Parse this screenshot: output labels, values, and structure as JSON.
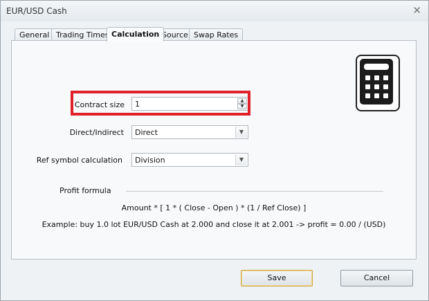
{
  "window": {
    "title": "EUR/USD Cash"
  },
  "tabs": [
    {
      "label": "General"
    },
    {
      "label": "Trading Times"
    },
    {
      "label": "Calculation"
    },
    {
      "label": "Source"
    },
    {
      "label": "Swap Rates"
    }
  ],
  "active_tab": "Calculation",
  "form": {
    "contract_size": {
      "label": "Contract size",
      "value": "1"
    },
    "direct_indirect": {
      "label": "Direct/Indirect",
      "value": "Direct"
    },
    "ref_symbol_calc": {
      "label": "Ref symbol calculation",
      "value": "Division"
    }
  },
  "profit": {
    "heading": "Profit formula",
    "formula": "Amount * [ 1 * ( Close - Open ) * (1 / Ref Close) ]",
    "example": "Example: buy 1.0 lot EUR/USD Cash at 2.000 and close it at 2.001 -> profit = 0.00 / (USD)"
  },
  "buttons": {
    "save": "Save",
    "cancel": "Cancel"
  },
  "colors": {
    "highlight": "#e0202a",
    "default_button_border": "#c9a54a"
  },
  "icons": {
    "close": "close-icon",
    "calculator": "calculator-icon"
  }
}
